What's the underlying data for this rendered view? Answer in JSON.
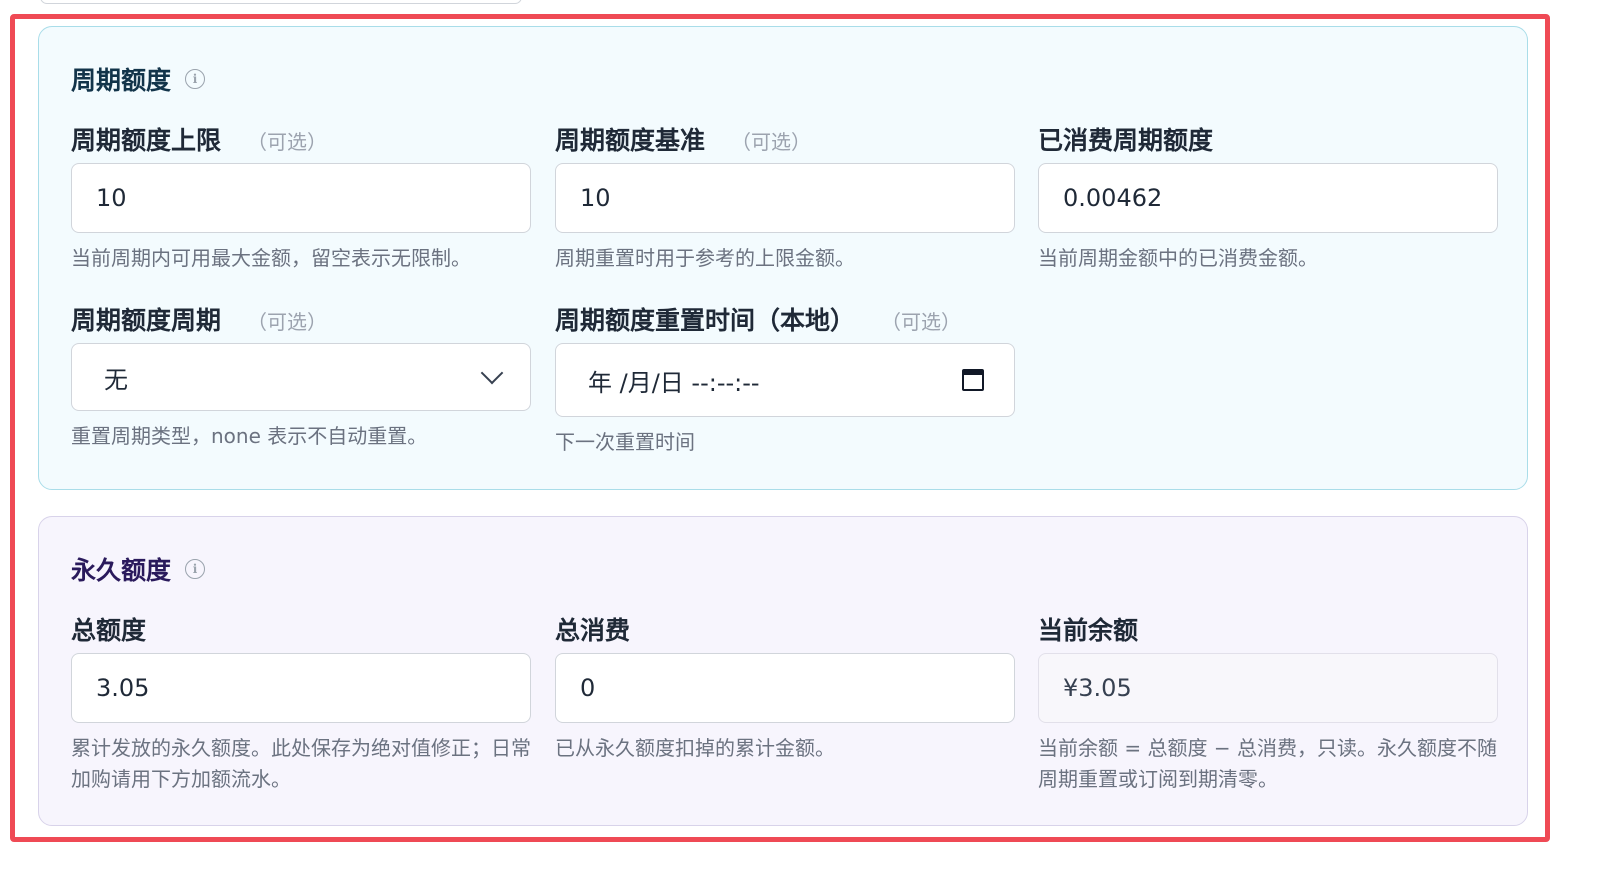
{
  "periodic": {
    "title": "周期额度",
    "fields": {
      "limit": {
        "label": "周期额度上限",
        "optional": "（可选）",
        "value": "10",
        "helper": "当前周期内可用最大金额，留空表示无限制。"
      },
      "base": {
        "label": "周期额度基准",
        "optional": "（可选）",
        "value": "10",
        "helper": "周期重置时用于参考的上限金额。"
      },
      "consumed": {
        "label": "已消费周期额度",
        "value": "0.00462",
        "helper": "当前周期金额中的已消费金额。"
      },
      "period": {
        "label": "周期额度周期",
        "optional": "（可选）",
        "selected": "无",
        "helper": "重置周期类型，none 表示不自动重置。"
      },
      "reset_time": {
        "label": "周期额度重置时间（本地）",
        "optional": "（可选）",
        "placeholder": "年 /月/日 --:--:--",
        "helper": "下一次重置时间"
      }
    }
  },
  "permanent": {
    "title": "永久额度",
    "fields": {
      "total": {
        "label": "总额度",
        "value": "3.05",
        "helper": "累计发放的永久额度。此处保存为绝对值修正；日常加购请用下方加额流水。"
      },
      "spent": {
        "label": "总消费",
        "value": "0",
        "helper": "已从永久额度扣掉的累计金额。"
      },
      "balance": {
        "label": "当前余额",
        "value": "¥3.05",
        "helper": "当前余额 = 总额度 − 总消费，只读。永久额度不随周期重置或订阅到期清零。"
      }
    }
  },
  "colors": {
    "highlight_frame": "#ef4a55",
    "periodic_bg": "#f3fbfe",
    "permanent_bg": "#f7f5fd"
  },
  "icons": {
    "section_info": "info-circle-icon",
    "select": "chevron-down-icon",
    "datetime": "calendar-icon"
  }
}
